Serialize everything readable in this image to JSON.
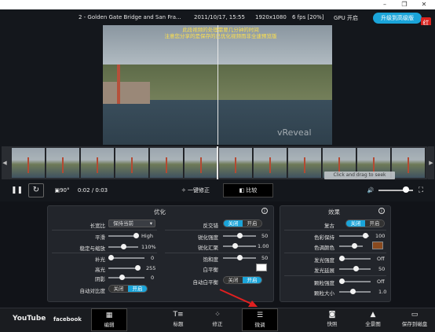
{
  "window": {
    "minimize": "–",
    "restore": "❐",
    "close": "✕"
  },
  "info": {
    "title": "2 - Golden Gate Bridge and San Fra...",
    "datetime": "2011/10/17, 15:55",
    "resolution": "1920x1080",
    "fps": "6 fps [20%]",
    "gpu": "GPU 开启",
    "upgrade": "升级到高级版",
    "hongbao": "红包"
  },
  "video": {
    "overlay_line1": "此段视频的处理需要几分钟的时间",
    "overlay_line2": "注意您分享的是保存的已优化视频而非全速预览版",
    "watermark": "vReveal"
  },
  "filmstrip": {
    "left_arrow": "◀",
    "right_arrow": "▶",
    "drag_hint": "Click and drag to seek"
  },
  "playback": {
    "pause": "❚❚",
    "loop": "↻",
    "rotate": "90°",
    "time": "0:02 / 0:03",
    "fix": "一键修正",
    "compare": "比较",
    "volume_icon": "🔊",
    "fullscreen": "⛶"
  },
  "optimize": {
    "title": "优化",
    "aspect_label": "长宽比",
    "aspect_value": "保持当前",
    "sharpen_label": "平滑",
    "sharpen_value": "High",
    "stabilize_label": "稳定与缩放",
    "stabilize_value": "110%",
    "fill_label": "补光",
    "fill_value": "0",
    "bright_label": "高光",
    "bright_value": "255",
    "shadow_label": "阴影",
    "shadow_value": "0",
    "autocontrast_label": "自动对比度",
    "interlace_label": "反交错",
    "sharp_strength_label": "锐化强度",
    "sharp_strength_value": "50",
    "sharp_radius_label": "锐化汇聚",
    "sharp_radius_value": "1.00",
    "saturation_label": "饱和度",
    "saturation_value": "50",
    "wb_label": "白平衡",
    "autowb_label": "自动白平衡",
    "off": "关闭",
    "on": "开启"
  },
  "effects": {
    "title": "效果",
    "vintage_label": "复古",
    "color_keep_label": "色彩保持",
    "color_keep_value": "100",
    "color_tint_label": "色调颜色",
    "glow_strength_label": "发光强度",
    "glow_strength_value": "Off",
    "glow_extend_label": "发光延展",
    "glow_extend_value": "50",
    "grain_strength_label": "颗粒强度",
    "grain_strength_value": "Off",
    "grain_size_label": "颗粒大小",
    "grain_size_value": "1.0",
    "off": "关闭",
    "on": "开启",
    "tint_color": "#8a4a1e"
  },
  "bottom": {
    "youtube": "YouTube",
    "facebook": "facebook",
    "edit": "编辑",
    "title": "标题",
    "fix": "修正",
    "tune": "微调",
    "snapshot": "快照",
    "panorama": "全景图",
    "save": "保存到磁盘"
  },
  "colors": {
    "accent": "#1aa4d9",
    "background": "#14171c",
    "panel": "#22252b",
    "arrow": "#e02020"
  }
}
